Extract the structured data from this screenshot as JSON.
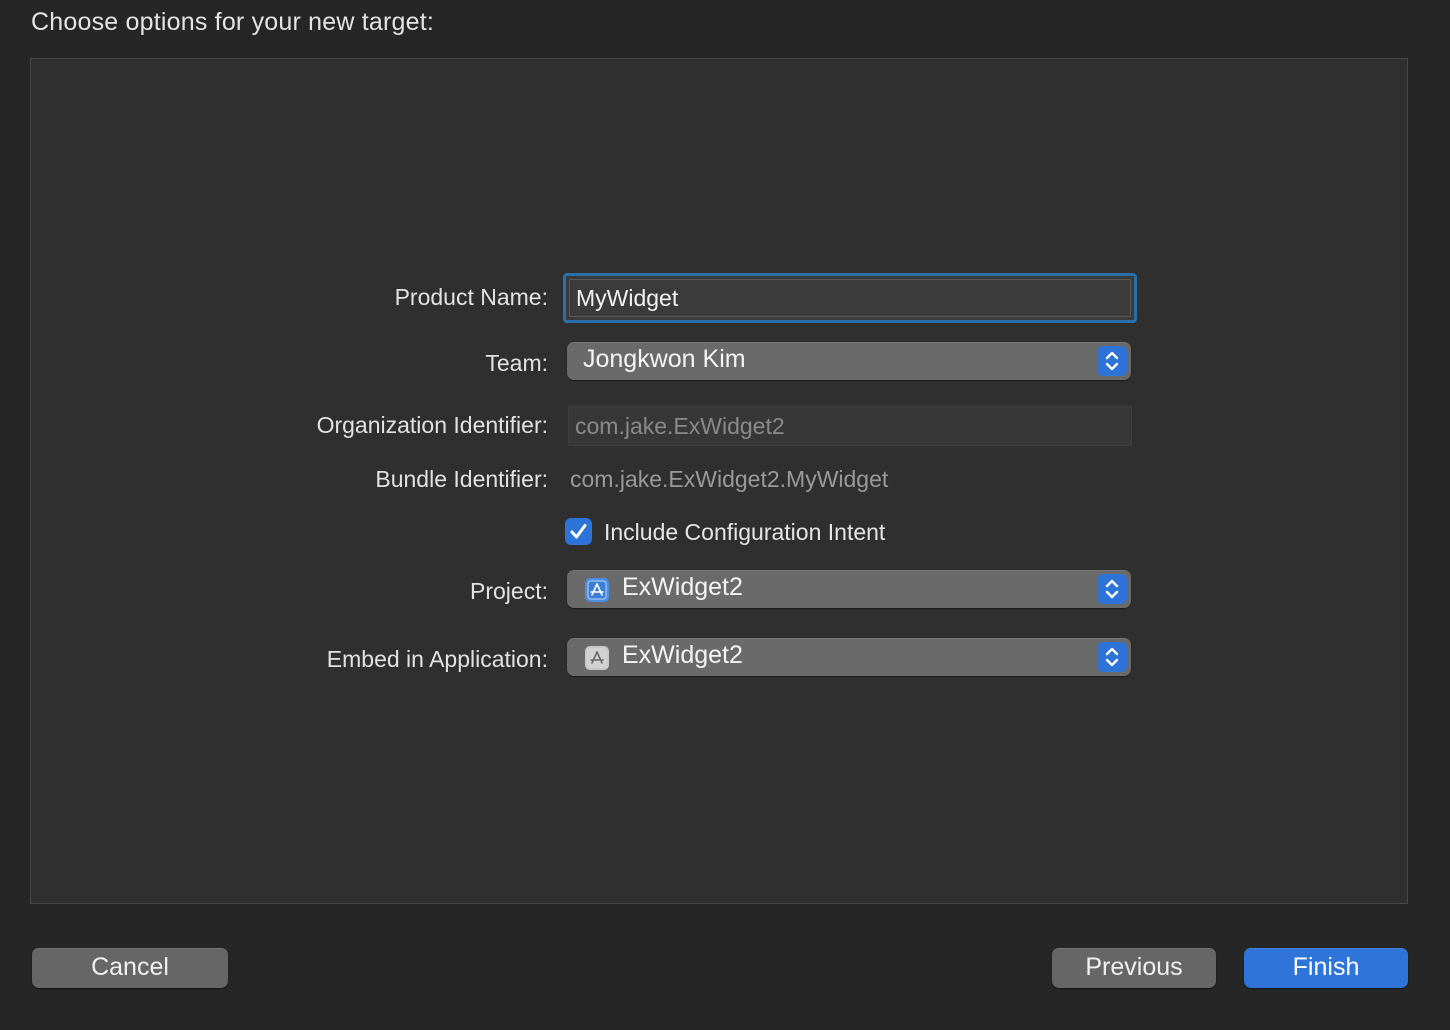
{
  "heading": "Choose options for your new target:",
  "form": {
    "product_name": {
      "label": "Product Name:",
      "value": "MyWidget"
    },
    "team": {
      "label": "Team:",
      "value": "Jongkwon Kim"
    },
    "organization_identifier": {
      "label": "Organization Identifier:",
      "value": "com.jake.ExWidget2"
    },
    "bundle_identifier": {
      "label": "Bundle Identifier:",
      "value": "com.jake.ExWidget2.MyWidget"
    },
    "include_configuration_intent": {
      "label": "Include Configuration Intent",
      "checked": true
    },
    "project": {
      "label": "Project:",
      "value": "ExWidget2",
      "icon": "xcode-project-icon"
    },
    "embed_in_application": {
      "label": "Embed in Application:",
      "value": "ExWidget2",
      "icon": "app-target-icon"
    }
  },
  "buttons": {
    "cancel": "Cancel",
    "previous": "Previous",
    "finish": "Finish"
  },
  "colors": {
    "accent": "#2f74d8",
    "focus_ring": "#2a6fa8",
    "background": "#262626",
    "panel": "#2f2f2f"
  }
}
